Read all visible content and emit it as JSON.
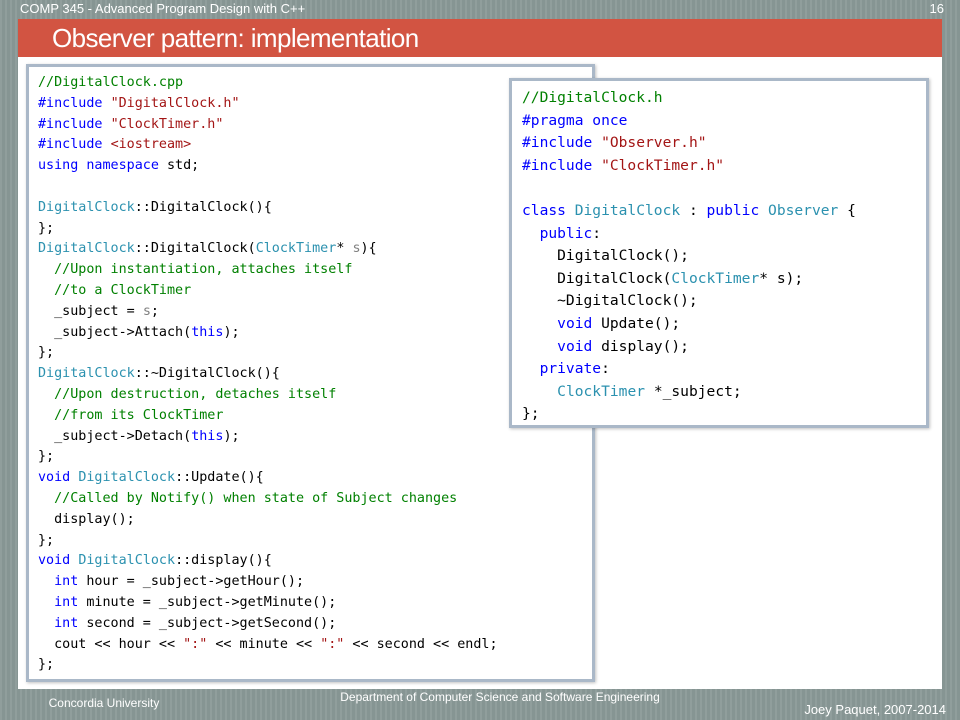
{
  "header": {
    "course": "COMP 345 - Advanced Program Design with C++",
    "page_number": "16"
  },
  "slide": {
    "title": "Observer pattern: implementation"
  },
  "colors": {
    "title_bar": "#d25442",
    "background": "#8b9a98",
    "box_border": "#aab8c8",
    "keyword": "#0000ff",
    "type": "#2b91af",
    "comment": "#008000",
    "string": "#a31515",
    "parameter": "#808080",
    "text": "#000000"
  },
  "cpp_file": {
    "lines": [
      [
        [
          "c",
          "//DigitalClock.cpp"
        ]
      ],
      [
        [
          "k",
          "#include "
        ],
        [
          "s",
          "\"DigitalClock.h\""
        ]
      ],
      [
        [
          "k",
          "#include "
        ],
        [
          "s",
          "\"ClockTimer.h\""
        ]
      ],
      [
        [
          "k",
          "#include "
        ],
        [
          "s",
          "<iostream>"
        ]
      ],
      [
        [
          "k",
          "using namespace "
        ],
        [
          "n",
          "std;"
        ]
      ],
      [],
      [
        [
          "t",
          "DigitalClock"
        ],
        [
          "n",
          "::DigitalClock(){"
        ]
      ],
      [
        [
          "n",
          "};"
        ]
      ],
      [
        [
          "t",
          "DigitalClock"
        ],
        [
          "n",
          "::DigitalClock("
        ],
        [
          "t",
          "ClockTimer"
        ],
        [
          "n",
          "* "
        ],
        [
          "p",
          "s"
        ],
        [
          "n",
          "){"
        ]
      ],
      [
        [
          "n",
          "  "
        ],
        [
          "c",
          "//Upon instantiation, attaches itself"
        ]
      ],
      [
        [
          "n",
          "  "
        ],
        [
          "c",
          "//to a ClockTimer"
        ]
      ],
      [
        [
          "n",
          "  _subject = "
        ],
        [
          "p",
          "s"
        ],
        [
          "n",
          ";"
        ]
      ],
      [
        [
          "n",
          "  _subject->Attach("
        ],
        [
          "k",
          "this"
        ],
        [
          "n",
          ");"
        ]
      ],
      [
        [
          "n",
          "};"
        ]
      ],
      [
        [
          "t",
          "DigitalClock"
        ],
        [
          "n",
          "::~DigitalClock(){"
        ]
      ],
      [
        [
          "n",
          "  "
        ],
        [
          "c",
          "//Upon destruction, detaches itself"
        ]
      ],
      [
        [
          "n",
          "  "
        ],
        [
          "c",
          "//from its ClockTimer"
        ]
      ],
      [
        [
          "n",
          "  _subject->Detach("
        ],
        [
          "k",
          "this"
        ],
        [
          "n",
          ");"
        ]
      ],
      [
        [
          "n",
          "};"
        ]
      ],
      [
        [
          "k",
          "void "
        ],
        [
          "t",
          "DigitalClock"
        ],
        [
          "n",
          "::Update(){"
        ]
      ],
      [
        [
          "n",
          "  "
        ],
        [
          "c",
          "//Called by Notify() when state of Subject changes"
        ]
      ],
      [
        [
          "n",
          "  display();"
        ]
      ],
      [
        [
          "n",
          "};"
        ]
      ],
      [
        [
          "k",
          "void "
        ],
        [
          "t",
          "DigitalClock"
        ],
        [
          "n",
          "::display(){"
        ]
      ],
      [
        [
          "n",
          "  "
        ],
        [
          "k",
          "int "
        ],
        [
          "n",
          "hour = _subject->getHour();"
        ]
      ],
      [
        [
          "n",
          "  "
        ],
        [
          "k",
          "int "
        ],
        [
          "n",
          "minute = _subject->getMinute();"
        ]
      ],
      [
        [
          "n",
          "  "
        ],
        [
          "k",
          "int "
        ],
        [
          "n",
          "second = _subject->getSecond();"
        ]
      ],
      [
        [
          "n",
          "  cout << hour << "
        ],
        [
          "s",
          "\":\""
        ],
        [
          "n",
          " << minute << "
        ],
        [
          "s",
          "\":\""
        ],
        [
          "n",
          " << second << endl;"
        ]
      ],
      [
        [
          "n",
          "};"
        ]
      ]
    ]
  },
  "header_file": {
    "lines": [
      [
        [
          "c",
          "//DigitalClock.h"
        ]
      ],
      [
        [
          "k",
          "#pragma once"
        ]
      ],
      [
        [
          "k",
          "#include "
        ],
        [
          "s",
          "\"Observer.h\""
        ]
      ],
      [
        [
          "k",
          "#include "
        ],
        [
          "s",
          "\"ClockTimer.h\""
        ]
      ],
      [],
      [
        [
          "k",
          "class "
        ],
        [
          "t",
          "DigitalClock"
        ],
        [
          "n",
          " : "
        ],
        [
          "k",
          "public "
        ],
        [
          "t",
          "Observer"
        ],
        [
          "n",
          " {"
        ]
      ],
      [
        [
          "n",
          "  "
        ],
        [
          "k",
          "public"
        ],
        [
          "n",
          ":"
        ]
      ],
      [
        [
          "n",
          "    DigitalClock();"
        ]
      ],
      [
        [
          "n",
          "    DigitalClock("
        ],
        [
          "t",
          "ClockTimer"
        ],
        [
          "n",
          "* s);"
        ]
      ],
      [
        [
          "n",
          "    ~DigitalClock();"
        ]
      ],
      [
        [
          "n",
          "    "
        ],
        [
          "k",
          "void "
        ],
        [
          "n",
          "Update();"
        ]
      ],
      [
        [
          "n",
          "    "
        ],
        [
          "k",
          "void "
        ],
        [
          "n",
          "display();"
        ]
      ],
      [
        [
          "n",
          "  "
        ],
        [
          "k",
          "private"
        ],
        [
          "n",
          ":"
        ]
      ],
      [
        [
          "n",
          "    "
        ],
        [
          "t",
          "ClockTimer"
        ],
        [
          "n",
          " *_subject;"
        ]
      ],
      [
        [
          "n",
          "};"
        ]
      ]
    ]
  },
  "footer": {
    "university": "Concordia University",
    "department": "Department of Computer Science and Software Engineering",
    "author": "Joey Paquet, 2007-2014"
  }
}
